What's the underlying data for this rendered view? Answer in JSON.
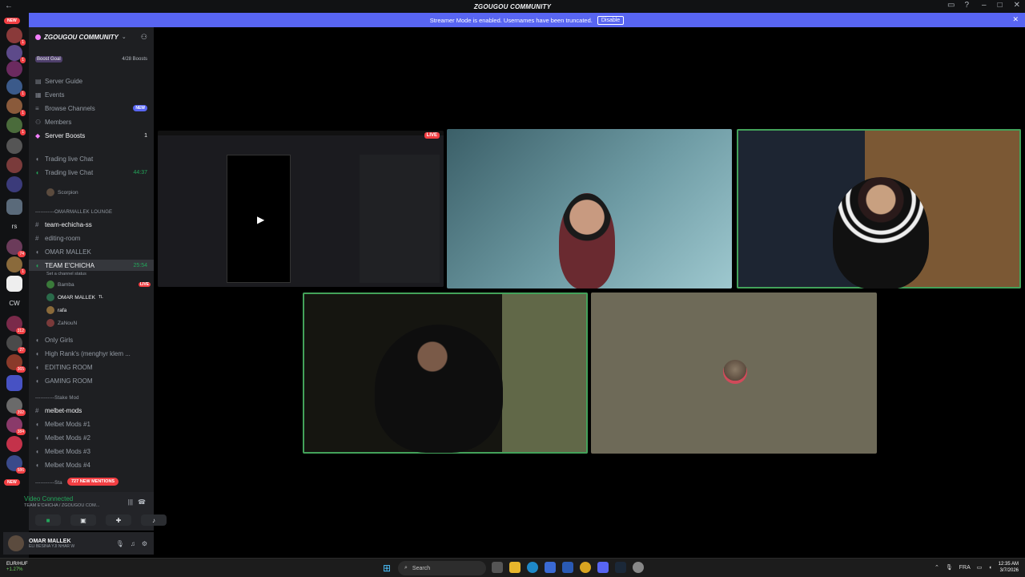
{
  "titlebar": {
    "title": "ZGOUGOU COMMUNITY"
  },
  "banner": {
    "message": "Streamer Mode is enabled. Usernames have been truncated.",
    "disable": "Disable"
  },
  "guilds": {
    "new_top": "NEW",
    "new_bottom": "NEW",
    "text_rs": "rs",
    "text_cw": "CW",
    "badges": [
      "1",
      "1",
      "1",
      "1",
      "1",
      "74",
      "1",
      "312",
      "27",
      "365",
      "392",
      "384",
      "586"
    ]
  },
  "server": {
    "name": "ZGOUGOU COMMUNITY",
    "boost_goal": "Boost Goal",
    "boost_count": "4/28 Boosts"
  },
  "menu": {
    "guide": "Server Guide",
    "events": "Events",
    "browse": "Browse Channels",
    "browse_badge": "NEW",
    "members": "Members",
    "boosts": "Server Boosts",
    "boosts_count": "1"
  },
  "channels": {
    "trading1": "Trading live Chat",
    "trading2": "Trading live Chat",
    "trading2_time": "44:37",
    "trading2_user": "Scorpion",
    "cat1": "-----------OMARMALLEK LOUNGE",
    "team_echicha_ss": "team-echicha-ss",
    "editing_room": "editing-room",
    "omar_mallek": "OMAR MALLEK",
    "team_echicha": "TEAM E'CHICHA",
    "team_echicha_time": "25:54",
    "status": "Set a channel status",
    "vu1": "Bamba",
    "vu1_live": "LIVE",
    "vu2": "OMAR MALLEK",
    "vu2_tag": "TL",
    "vu3": "rafa",
    "vu4": "ZaNouN",
    "only_girls": "Only Girls",
    "high_ranks": "High Rank's (menghyr klem ...",
    "editing_room2": "EDITING ROOM",
    "gaming_room": "GAMING ROOM",
    "cat2": "-----------Stake Mod",
    "melbet_mods": "melbet-mods",
    "mods1": "Melbet Mods #1",
    "mods2": "Melbet Mods #2",
    "mods3": "Melbet Mods #3",
    "mods4": "Melbet Mods #4",
    "cat3": "-----------Sta",
    "mentions": "727 NEW MENTIONS"
  },
  "voice": {
    "status": "Video Connected",
    "channel": "TEAM E'CHICHA / ZGOUGOU COM..."
  },
  "user": {
    "name": "OMAR MALLEK",
    "status": "ELI BESINA YJI NHAR W"
  },
  "stream": {
    "live": "LIVE"
  },
  "taskbar": {
    "ticker": "EUR/HUF",
    "change": "+1.27%",
    "search": "Search",
    "lang": "FRA",
    "time": "12:35 AM",
    "date": "3/7/2026"
  }
}
